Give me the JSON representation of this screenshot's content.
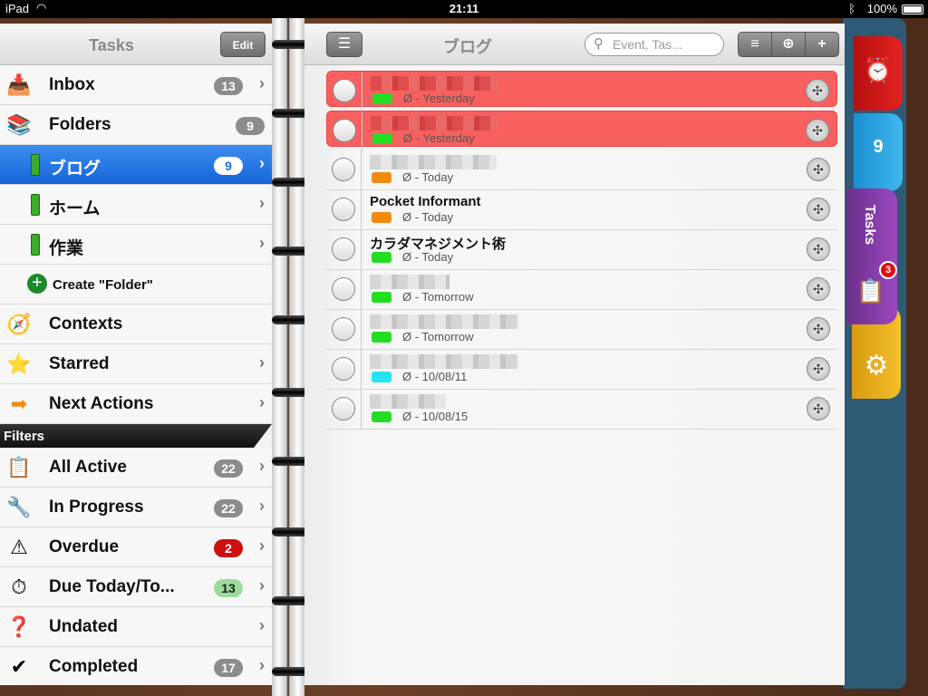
{
  "status": {
    "device": "iPad",
    "time": "21:11",
    "battery": "100%"
  },
  "sidebar": {
    "title": "Tasks",
    "edit_label": "Edit",
    "items": [
      {
        "label": "Inbox",
        "count": "13",
        "icon": "inbox-icon"
      },
      {
        "label": "Folders",
        "count": "9",
        "icon": "folders-icon"
      },
      {
        "label": "ブログ",
        "count": "9",
        "icon": "folder-icon"
      },
      {
        "label": "ホーム",
        "count": "",
        "icon": "folder-icon"
      },
      {
        "label": "作業",
        "count": "",
        "icon": "folder-icon"
      },
      {
        "label": "Create \"Folder\"",
        "count": "",
        "icon": "plus-circle-icon"
      },
      {
        "label": "Contexts",
        "count": "",
        "icon": "contexts-icon"
      },
      {
        "label": "Starred",
        "count": "",
        "icon": "star-icon"
      },
      {
        "label": "Next Actions",
        "count": "",
        "icon": "arrow-right-icon"
      }
    ],
    "filters_label": "Filters",
    "filters": [
      {
        "label": "All Active",
        "count": "22",
        "icon": "checklist-icon"
      },
      {
        "label": "In Progress",
        "count": "22",
        "icon": "wrench-icon"
      },
      {
        "label": "Overdue",
        "count": "2",
        "icon": "warning-icon",
        "color": "#cc1010"
      },
      {
        "label": "Due Today/To...",
        "count": "13",
        "icon": "stopwatch-icon",
        "color": "#9bdc9b"
      },
      {
        "label": "Undated",
        "count": "",
        "icon": "question-icon"
      },
      {
        "label": "Completed",
        "count": "17",
        "icon": "checkmark-icon"
      }
    ]
  },
  "main": {
    "title": "ブログ",
    "search_placeholder": "Event, Tas...",
    "tasks": [
      {
        "title": "",
        "due": "Ø  -  Yesterday",
        "tag_color": "#22dd22",
        "highlight": true
      },
      {
        "title": "",
        "due": "Ø  -  Yesterday",
        "tag_color": "#22dd22",
        "highlight": true
      },
      {
        "title": "",
        "due": "Ø  -  Today",
        "tag_color": "#f08a10",
        "highlight": false
      },
      {
        "title": "Pocket Informant",
        "due": "Ø  -  Today",
        "tag_color": "#f08a10",
        "highlight": false
      },
      {
        "title": "カラダマネジメント術",
        "due": "Ø  -  Today",
        "tag_color": "#22dd22",
        "highlight": false
      },
      {
        "title": "",
        "due": "Ø  -  Tomorrow",
        "tag_color": "#22dd22",
        "highlight": false
      },
      {
        "title": "",
        "due": "Ø  -  Tomorrow",
        "tag_color": "#22dd22",
        "highlight": false
      },
      {
        "title": "",
        "due": "Ø  -  10/08/11",
        "tag_color": "#22e4f4",
        "highlight": false
      },
      {
        "title": "",
        "due": "Ø  -  10/08/15",
        "tag_color": "#22dd22",
        "highlight": false
      }
    ]
  },
  "tabs": {
    "tasks_label": "Tasks",
    "tasks_badge": "3",
    "calendar_day": "9"
  }
}
